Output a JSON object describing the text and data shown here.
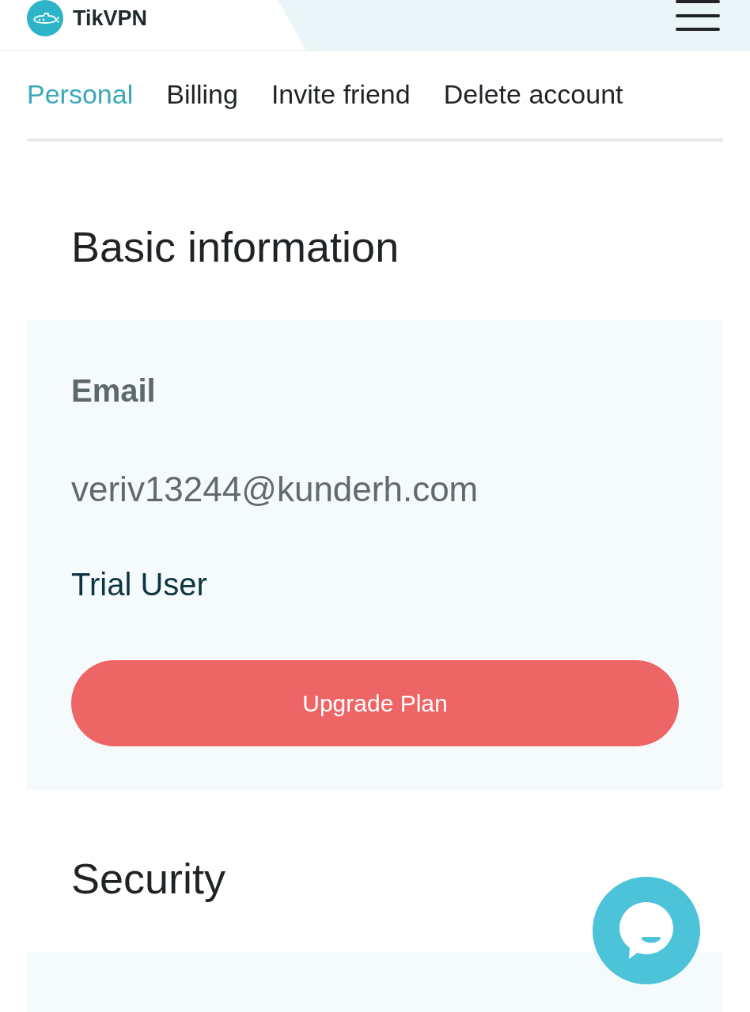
{
  "header": {
    "brand": "TikVPN"
  },
  "tabs": [
    {
      "label": "Personal",
      "selected": true
    },
    {
      "label": "Billing",
      "selected": false
    },
    {
      "label": "Invite friend",
      "selected": false
    },
    {
      "label": "Delete account",
      "selected": false
    }
  ],
  "basic_information": {
    "title": "Basic information",
    "email_label": "Email",
    "email": "veriv13244@kunderh.com",
    "account_type": "Trial User",
    "upgrade_button": "Upgrade Plan"
  },
  "security": {
    "title": "Security"
  }
}
